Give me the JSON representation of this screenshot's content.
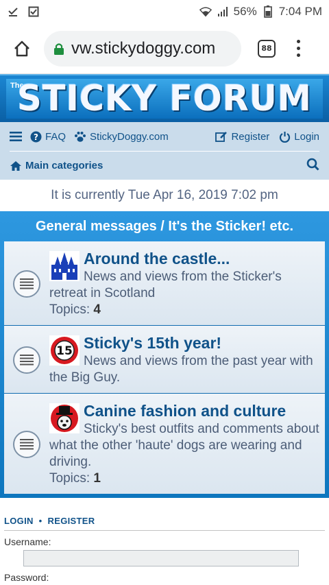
{
  "status_bar": {
    "left_icons": [
      "download-done-icon",
      "checkbox-icon"
    ],
    "battery_percent": "56%",
    "time": "7:04 PM"
  },
  "browser": {
    "url": "vw.stickydoggy.com",
    "tab_count": "88"
  },
  "header": {
    "small_text": "The",
    "logo_text": "STICKY FORUM"
  },
  "nav": {
    "faq": "FAQ",
    "site_link": "StickyDoggy.com",
    "register": "Register",
    "login": "Login",
    "main_categories": "Main categories"
  },
  "current_time": "It is currently Tue Apr 16, 2019 7:02 pm",
  "category": {
    "title": "General messages / It's the Sticker! etc.",
    "forums": [
      {
        "title": "Around the castle...",
        "description": "News and views from the Sticker's retreat in Scotland",
        "topics_label": "Topics:",
        "topics_count": "4"
      },
      {
        "title": "Sticky's 15th year!",
        "description": "News and views from the past year with the Big Guy.",
        "badge_text": "15"
      },
      {
        "title": "Canine fashion and culture",
        "description": "Sticky's best outfits and comments about what the other 'haute' dogs are wearing and driving.",
        "topics_label": "Topics:",
        "topics_count": "1"
      }
    ]
  },
  "login_box": {
    "login_link": "LOGIN",
    "separator": "•",
    "register_link": "REGISTER",
    "username_label": "Username:",
    "password_label": "Password:"
  },
  "colors": {
    "nav_bg": "#cadceb",
    "link": "#105289",
    "header_blue": "#0e76c4",
    "lock_green": "#1e8e3e"
  }
}
